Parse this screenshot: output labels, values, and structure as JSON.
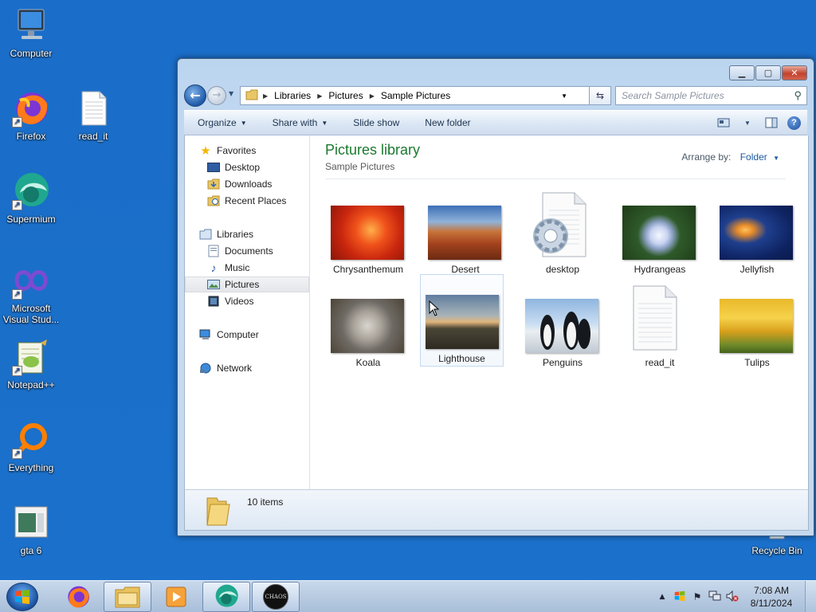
{
  "desktop": {
    "icons": [
      {
        "label": "Computer"
      },
      {
        "label": "Firefox"
      },
      {
        "label": "read_it"
      },
      {
        "label": "Supermium"
      },
      {
        "label": "Microsoft Visual Stud..."
      },
      {
        "label": "Notepad++"
      },
      {
        "label": "Everything"
      },
      {
        "label": "gta 6"
      },
      {
        "label": "Recycle Bin"
      }
    ]
  },
  "window": {
    "address": {
      "crumbs": [
        "Libraries",
        "Pictures",
        "Sample Pictures"
      ]
    },
    "search_placeholder": "Search Sample Pictures",
    "toolbar": {
      "organize": "Organize",
      "share_with": "Share with",
      "slide_show": "Slide show",
      "new_folder": "New folder"
    },
    "nav": {
      "favorites": "Favorites",
      "desktop": "Desktop",
      "downloads": "Downloads",
      "recent_places": "Recent Places",
      "libraries": "Libraries",
      "documents": "Documents",
      "music": "Music",
      "pictures": "Pictures",
      "videos": "Videos",
      "computer": "Computer",
      "network": "Network"
    },
    "main": {
      "title": "Pictures library",
      "subtitle": "Sample Pictures",
      "arrange_label": "Arrange by:",
      "arrange_value": "Folder"
    },
    "files": [
      {
        "name": "Chrysanthemum"
      },
      {
        "name": "Desert"
      },
      {
        "name": "desktop"
      },
      {
        "name": "Hydrangeas"
      },
      {
        "name": "Jellyfish"
      },
      {
        "name": "Koala"
      },
      {
        "name": "Lighthouse"
      },
      {
        "name": "Penguins"
      },
      {
        "name": "read_it"
      },
      {
        "name": "Tulips"
      }
    ],
    "details": {
      "count": "10 items"
    }
  },
  "taskbar": {
    "clock_time": "7:08 AM",
    "clock_date": "8/11/2024",
    "chaos_label": "CHAOS"
  }
}
